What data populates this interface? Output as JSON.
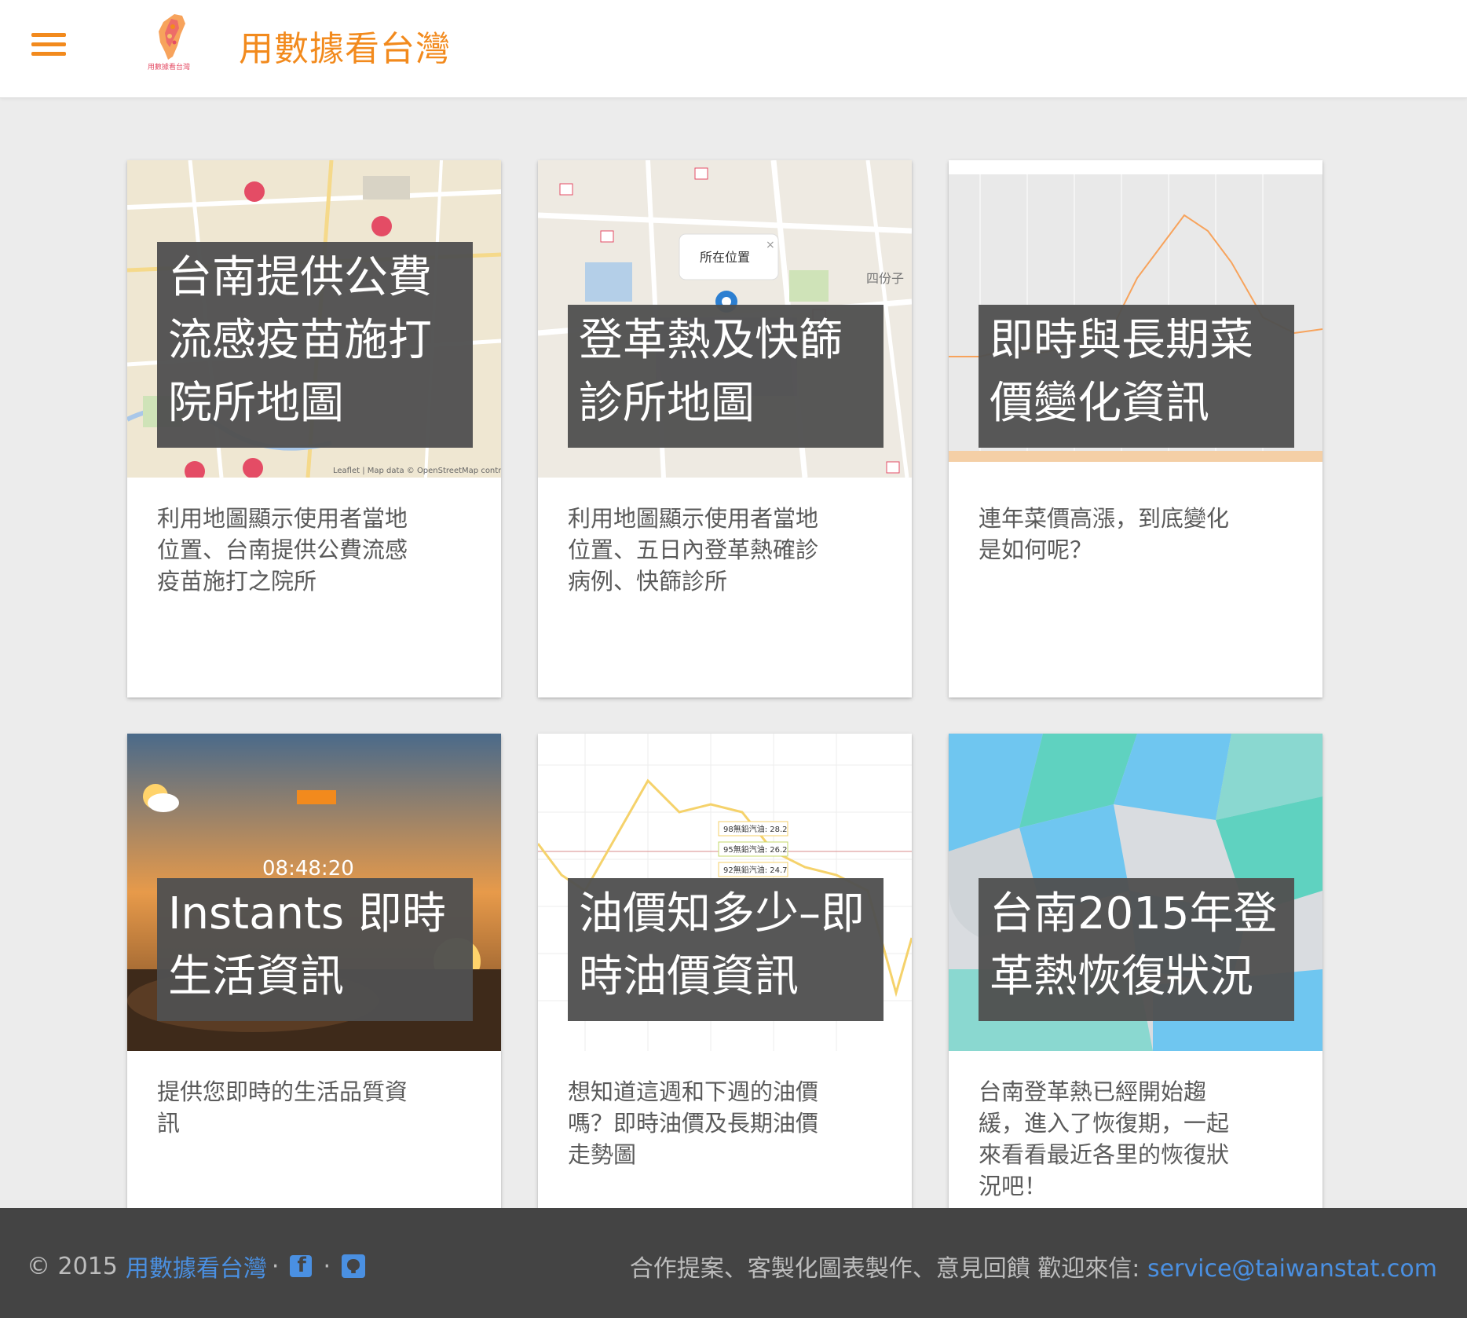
{
  "header": {
    "site_title": "用數據看台灣",
    "logo_text": "用數據看台灣"
  },
  "cards": [
    {
      "title": "台南提供公費\n流感疫苗施打\n院所地圖",
      "description": "利用地圖顯示使用者當地\n位置、台南提供公費流感\n疫苗施打之院所",
      "thumb_caption": "Leaflet | Map data © OpenStreetMap contributo"
    },
    {
      "title": "登革熱及快篩\n診所地圖",
      "description": "利用地圖顯示使用者當地\n位置、五日內登革熱確診\n病例、快篩診所",
      "popup_label": "所在位置",
      "map_label": "四份子"
    },
    {
      "title": "即時與長期菜\n價變化資訊",
      "description": "連年菜價高漲，到底變化\n是如何呢？"
    },
    {
      "title": "Instants 即時\n生活資訊",
      "description": "提供您即時的生活品質資\n訊",
      "clock": "08:48:20"
    },
    {
      "title": "油價知多少–即\n時油價資訊",
      "description": "想知道這週和下週的油價\n嗎？即時油價及長期油價\n走勢圖",
      "price_labels": [
        "98無鉛汽油: 28.2",
        "95無鉛汽油: 26.2",
        "92無鉛汽油: 24.7"
      ]
    },
    {
      "title": "台南2015年登\n革熱恢復狀況",
      "description": "台南登革熱已經開始趨\n緩，進入了恢復期，一起\n來看看最近各里的恢復狀\n況吧！"
    }
  ],
  "footer": {
    "copyright": "© 2015",
    "brand": "用數據看台灣",
    "separator": "·",
    "contact_text": "合作提案、客製化圖表製作、意見回饋 歡迎來信:",
    "email": "service@taiwanstat.com"
  },
  "colors": {
    "accent": "#f28a1d",
    "link": "#4a90e2",
    "footer_bg": "#444444",
    "title_overlay": "#505050"
  }
}
